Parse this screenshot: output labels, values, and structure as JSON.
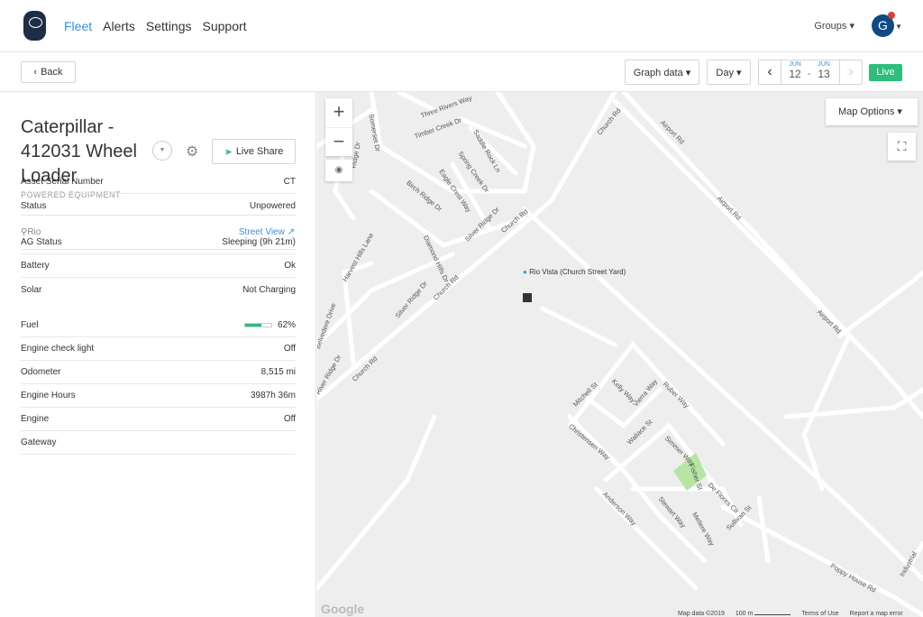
{
  "nav": {
    "items": [
      "Fleet",
      "Alerts",
      "Settings",
      "Support"
    ],
    "groups": "Groups ▾",
    "avatar": "G"
  },
  "toolbar": {
    "back": "Back",
    "graph_data": "Graph data ▾",
    "day": "Day ▾",
    "start_month": "JUN",
    "start_day": "12",
    "end_month": "JUN",
    "end_day": "13",
    "sep": "-",
    "live": "Live"
  },
  "asset": {
    "title": "Caterpillar - 412031 Wheel Loader",
    "type": "POWERED EQUIPMENT",
    "live_share": "Live Share",
    "location": "Rio",
    "street_view": "Street View",
    "rows": [
      [
        "Asset Serial Number",
        "CT"
      ],
      [
        "Status",
        "Unpowered"
      ],
      [
        "AG Status",
        "Sleeping (9h 21m)"
      ],
      [
        "Battery",
        "Ok"
      ],
      [
        "Solar",
        "Not Charging"
      ],
      [
        "Fuel",
        "62%"
      ],
      [
        "Engine check light",
        "Off"
      ],
      [
        "Odometer",
        "8,515 mi"
      ],
      [
        "Engine Hours",
        "3987h 36m"
      ],
      [
        "Engine",
        "Off"
      ],
      [
        "Gateway",
        ""
      ]
    ],
    "fuel_percent": 62
  },
  "map": {
    "options": "Map Options",
    "marker": "Rio Vista (Church Street Yard)",
    "zoom_in": "+",
    "zoom_out": "−",
    "attribution": "Map data ©2019",
    "scale": "100 m",
    "terms": "Terms of Use",
    "report": "Report a map error",
    "google": "Google",
    "streets": [
      "Three Rivers Way",
      "Timber Creek Dr",
      "Saddle Rock Ln",
      "Spring Creek Dr",
      "Eagle Crest Way",
      "Birch Ridge Dr",
      "Silver Ridge Dr",
      "Church Rd",
      "Church Rd",
      "Church Rd",
      "Church Rd",
      "Airport Rd",
      "Airport Rd",
      "Airport Rd",
      "Diamond Hills Dr",
      "Harvest Hills Lane",
      "Silver Ridge Dr",
      "Belvedere Drive",
      "Mitchell St",
      "Kelly Way",
      "Vierra Way",
      "Ruber Way",
      "Christensen Way",
      "Wallace St",
      "Simmer Way",
      "Fisher St",
      "De Flores Cir",
      "Anderson Way",
      "Stewart Way",
      "Mellere Way",
      "Sullivan St",
      "Poppy House Rd",
      "Industrial",
      "Ridge Dr",
      "Somerset Dr",
      "River Ridge Dr"
    ]
  },
  "colors": {
    "accent": "#3a8ee6",
    "live": "#2ebd7b",
    "navy": "#1c2e45"
  }
}
